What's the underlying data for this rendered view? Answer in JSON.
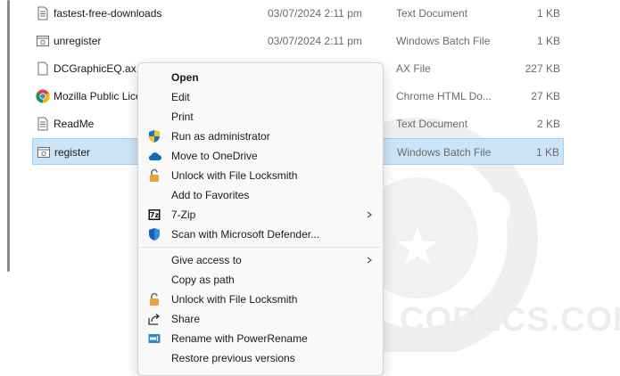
{
  "files": [
    {
      "name": "fastest-free-downloads",
      "date": "03/07/2024 2:11 pm",
      "type": "Text Document",
      "size": "1 KB",
      "icon": "text-document-icon"
    },
    {
      "name": "unregister",
      "date": "03/07/2024 2:11 pm",
      "type": "Windows Batch File",
      "size": "1 KB",
      "icon": "batch-file-icon"
    },
    {
      "name": "DCGraphicEQ.ax",
      "date": "",
      "type": "AX File",
      "size": "227 KB",
      "icon": "blank-file-icon"
    },
    {
      "name": "Mozilla Public Lice",
      "date": "",
      "type": "Chrome HTML Do...",
      "size": "27 KB",
      "icon": "chrome-icon"
    },
    {
      "name": "ReadMe",
      "date": "",
      "type": "Text Document",
      "size": "2 KB",
      "icon": "text-document-icon"
    },
    {
      "name": "register",
      "date": "",
      "type": "Windows Batch File",
      "size": "1 KB",
      "icon": "batch-file-icon",
      "selected": true
    }
  ],
  "context_menu": {
    "items": [
      {
        "label": "Open",
        "bold": true,
        "icon": ""
      },
      {
        "label": "Edit",
        "icon": ""
      },
      {
        "label": "Print",
        "icon": ""
      },
      {
        "label": "Run as administrator",
        "icon": "uac-shield-icon"
      },
      {
        "label": "Move to OneDrive",
        "icon": "onedrive-cloud-icon"
      },
      {
        "label": "Unlock with File Locksmith",
        "icon": "lock-icon"
      },
      {
        "label": "Add to Favorites",
        "icon": ""
      },
      {
        "label": "7-Zip",
        "icon": "7zip-icon",
        "submenu": true
      },
      {
        "label": "Scan with Microsoft Defender...",
        "icon": "defender-shield-icon"
      },
      {
        "label": "Give access to",
        "icon": "",
        "submenu": true
      },
      {
        "label": "Copy as path",
        "icon": ""
      },
      {
        "label": "Unlock with File Locksmith",
        "icon": "lock-icon"
      },
      {
        "label": "Share",
        "icon": "share-icon"
      },
      {
        "label": "Rename with PowerRename",
        "icon": "power-rename-icon"
      },
      {
        "label": "Restore previous versions",
        "icon": ""
      }
    ]
  },
  "watermark": {
    "text": "CODECS.COM"
  },
  "colors": {
    "selection": "#cce4f7",
    "selection_border": "#99d1ff",
    "menu_bg": "#f9f9f9"
  }
}
